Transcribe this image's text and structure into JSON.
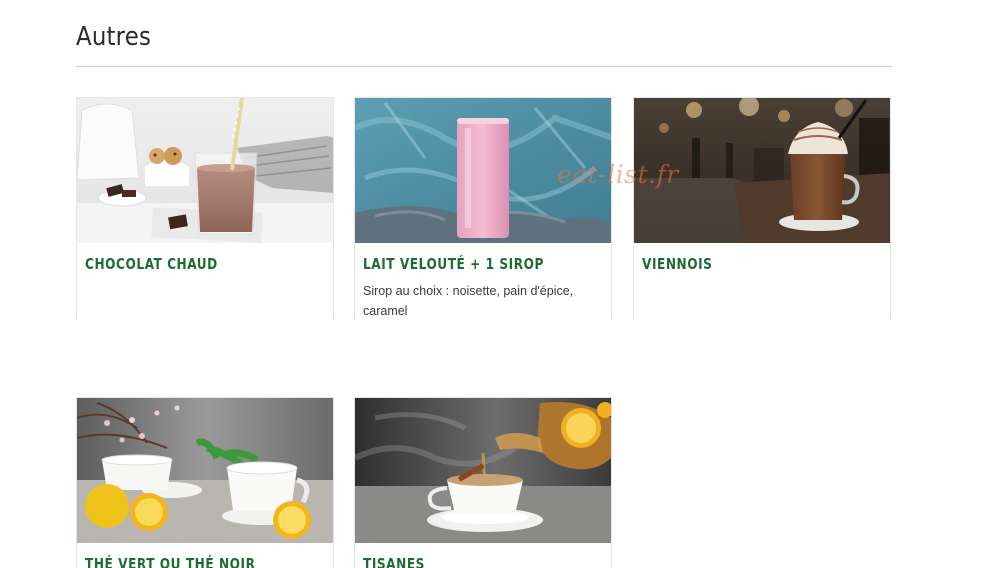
{
  "section": {
    "title": "Autres"
  },
  "watermark": "eat-list.fr",
  "products": [
    {
      "name": "CHOCOLAT CHAUD",
      "description": "",
      "image": "hot-chocolate-glass-photo"
    },
    {
      "name": "LAIT VELOUTÉ + 1 SIROP",
      "description": "Sirop au choix : noisette, pain d'épice, caramel",
      "image": "pink-milkshake-glass-photo"
    },
    {
      "name": "VIENNOIS",
      "description": "",
      "image": "whipped-cream-chocolate-mug-photo"
    },
    {
      "name": "THÉ VERT OU THÉ NOIR",
      "description": "",
      "image": "tea-cups-lemons-photo"
    },
    {
      "name": "TISANES",
      "description": "",
      "image": "herbal-tea-pouring-photo"
    }
  ],
  "colors": {
    "accent": "#1e6b34",
    "divider": "#cfcfcf",
    "watermark": "#e87846"
  }
}
